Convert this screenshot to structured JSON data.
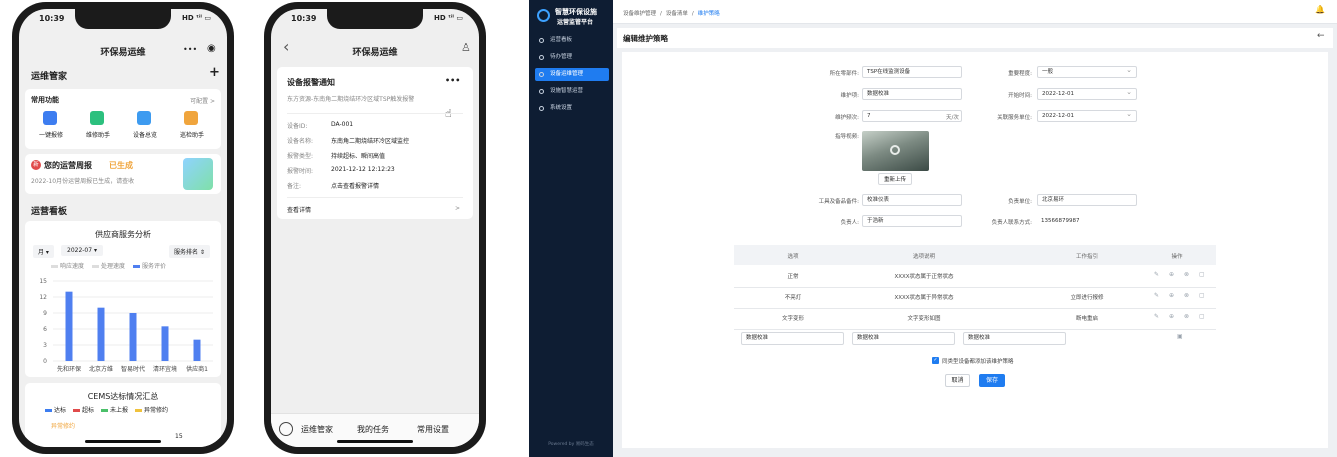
{
  "phone1": {
    "status_time": "10:39",
    "status_icons": "HD ᵗⁱˡ ▭",
    "title": "环保易运维",
    "more": "•••",
    "rec": "◉",
    "section_title": "运维管家",
    "add": "+",
    "common_title": "常用功能",
    "configurable": "可配置 >",
    "functions": [
      {
        "label": "一键报修",
        "color": "#3d7df0"
      },
      {
        "label": "维修助手",
        "color": "#2cc07e"
      },
      {
        "label": "设备总览",
        "color": "#3d9bf0"
      },
      {
        "label": "巡检助手",
        "color": "#f0a53d"
      }
    ],
    "report_badge": "新",
    "report_title": "您的运营周报",
    "report_status": "已生成",
    "report_sub": "2022-10月份运营周报已生成，请查收",
    "board_title": "运营看板",
    "chart_card_title": "供应商服务分析",
    "filters": {
      "month": "月 ▾",
      "date": "2022-07 ▾",
      "rank": "服务排名 ⇕"
    },
    "legend": [
      "响应速度",
      "处理速度",
      "服务评价"
    ],
    "bottom_title": "CEMS达标情况汇总",
    "bottom_legend": [
      {
        "label": "达标",
        "color": "#3d7df0"
      },
      {
        "label": "超标",
        "color": "#e04b4b"
      },
      {
        "label": "未上报",
        "color": "#4bc06a"
      },
      {
        "label": "异常修约",
        "color": "#f0c23d"
      }
    ],
    "bottom_tag": "异常修约",
    "bottom_value": "15"
  },
  "chart_data": {
    "type": "bar",
    "categories": [
      "先和环保",
      "北京方维",
      "智易时代",
      "清环宜境",
      "供应商1"
    ],
    "series": [
      {
        "name": "服务评价",
        "values": [
          13,
          10,
          9,
          6.5,
          4
        ]
      }
    ],
    "ylim": [
      0,
      15
    ],
    "yticks": [
      "15",
      "12",
      "9",
      "6",
      "3",
      "0"
    ],
    "color": "#4f7ff0"
  },
  "phone2": {
    "status_time": "10:39",
    "status_icons": "HD ᵗⁱˡ ▭",
    "back": "‹",
    "title": "环保易运维",
    "user": "♙",
    "notice_title": "设备报警通知",
    "more": "•••",
    "notice_sub": "东方资源-东南角二期烧结环冷区域TSP触发报警",
    "fields": [
      {
        "k": "设备ID:",
        "v": "DA-001"
      },
      {
        "k": "设备名称:",
        "v": "东南角二期烧结环冷区域监控"
      },
      {
        "k": "报警类型:",
        "v": "持续超标、瞬间高值"
      },
      {
        "k": "报警时间:",
        "v": "2021-12-12 12:12:23"
      },
      {
        "k": "备注:",
        "v": "点击查看报警详情"
      }
    ],
    "detail": "查看详情",
    "detail_arrow": ">",
    "tabs": [
      "运维管家",
      "我的任务",
      "常用设置"
    ]
  },
  "desktop": {
    "brand1": "智慧环保设施",
    "brand2": "运营监管平台",
    "nav": [
      "运营看板",
      "待办管理",
      "设备运维管理",
      "设施智慧运营",
      "系统设置"
    ],
    "footer": "Powered by 易码生态",
    "breadcrumb": [
      "设备维护管理",
      "/",
      "设备清单",
      "/",
      "维护策略"
    ],
    "bell": "🔔",
    "page_title": "编辑维护策略",
    "back": "←",
    "form": {
      "part_label": "所在零部件:",
      "part_value": "TSP在线监测设备",
      "importance_label": "重要程度:",
      "importance_value": "一般",
      "item_label": "维护项:",
      "item_value": "数据校准",
      "start_label": "开始时间:",
      "start_value": "2022-12-01",
      "period_label": "维护频次:",
      "period_value": "7",
      "period_unit": "天/次",
      "related_label": "关联服务单位:",
      "related_value": "2022-12-01",
      "video_label": "指导视频:",
      "reupload": "重新上传",
      "tools_label": "工具及备品备件:",
      "tools_value": "校准仪表",
      "unit_label": "负责单位:",
      "unit_value": "北京易环",
      "person_label": "负责人:",
      "person_value": "于浩新",
      "contact_label": "负责人联系方式:",
      "contact_value": "13566879987"
    },
    "table": {
      "headers": [
        "选项",
        "选项说明",
        "工作指引",
        "操作"
      ],
      "rows": [
        [
          "正常",
          "XXXX状态属于正常状态",
          ""
        ],
        [
          "不亮灯",
          "XXXX状态属于异常状态",
          "立即进行报修"
        ],
        [
          "文字变形",
          "文字变形如图",
          "断电重启"
        ]
      ],
      "inputs": [
        "数据校准",
        "数据校准",
        "数据校准"
      ]
    },
    "checkbox_label": "同类型设备都添加该维护策略",
    "cancel": "取消",
    "save": "保存"
  }
}
